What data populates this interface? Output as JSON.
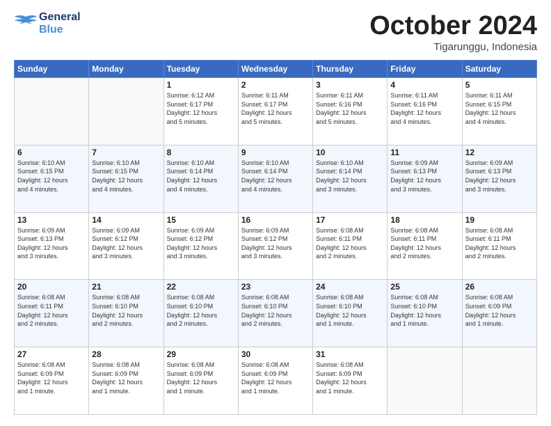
{
  "header": {
    "logo": {
      "line1": "General",
      "line2": "Blue"
    },
    "title": "October 2024",
    "subtitle": "Tigarunggu, Indonesia"
  },
  "days_of_week": [
    "Sunday",
    "Monday",
    "Tuesday",
    "Wednesday",
    "Thursday",
    "Friday",
    "Saturday"
  ],
  "weeks": [
    [
      {
        "day": "",
        "text": ""
      },
      {
        "day": "",
        "text": ""
      },
      {
        "day": "1",
        "text": "Sunrise: 6:12 AM\nSunset: 6:17 PM\nDaylight: 12 hours\nand 5 minutes."
      },
      {
        "day": "2",
        "text": "Sunrise: 6:11 AM\nSunset: 6:17 PM\nDaylight: 12 hours\nand 5 minutes."
      },
      {
        "day": "3",
        "text": "Sunrise: 6:11 AM\nSunset: 6:16 PM\nDaylight: 12 hours\nand 5 minutes."
      },
      {
        "day": "4",
        "text": "Sunrise: 6:11 AM\nSunset: 6:16 PM\nDaylight: 12 hours\nand 4 minutes."
      },
      {
        "day": "5",
        "text": "Sunrise: 6:11 AM\nSunset: 6:15 PM\nDaylight: 12 hours\nand 4 minutes."
      }
    ],
    [
      {
        "day": "6",
        "text": "Sunrise: 6:10 AM\nSunset: 6:15 PM\nDaylight: 12 hours\nand 4 minutes."
      },
      {
        "day": "7",
        "text": "Sunrise: 6:10 AM\nSunset: 6:15 PM\nDaylight: 12 hours\nand 4 minutes."
      },
      {
        "day": "8",
        "text": "Sunrise: 6:10 AM\nSunset: 6:14 PM\nDaylight: 12 hours\nand 4 minutes."
      },
      {
        "day": "9",
        "text": "Sunrise: 6:10 AM\nSunset: 6:14 PM\nDaylight: 12 hours\nand 4 minutes."
      },
      {
        "day": "10",
        "text": "Sunrise: 6:10 AM\nSunset: 6:14 PM\nDaylight: 12 hours\nand 3 minutes."
      },
      {
        "day": "11",
        "text": "Sunrise: 6:09 AM\nSunset: 6:13 PM\nDaylight: 12 hours\nand 3 minutes."
      },
      {
        "day": "12",
        "text": "Sunrise: 6:09 AM\nSunset: 6:13 PM\nDaylight: 12 hours\nand 3 minutes."
      }
    ],
    [
      {
        "day": "13",
        "text": "Sunrise: 6:09 AM\nSunset: 6:13 PM\nDaylight: 12 hours\nand 3 minutes."
      },
      {
        "day": "14",
        "text": "Sunrise: 6:09 AM\nSunset: 6:12 PM\nDaylight: 12 hours\nand 3 minutes."
      },
      {
        "day": "15",
        "text": "Sunrise: 6:09 AM\nSunset: 6:12 PM\nDaylight: 12 hours\nand 3 minutes."
      },
      {
        "day": "16",
        "text": "Sunrise: 6:09 AM\nSunset: 6:12 PM\nDaylight: 12 hours\nand 3 minutes."
      },
      {
        "day": "17",
        "text": "Sunrise: 6:08 AM\nSunset: 6:11 PM\nDaylight: 12 hours\nand 2 minutes."
      },
      {
        "day": "18",
        "text": "Sunrise: 6:08 AM\nSunset: 6:11 PM\nDaylight: 12 hours\nand 2 minutes."
      },
      {
        "day": "19",
        "text": "Sunrise: 6:08 AM\nSunset: 6:11 PM\nDaylight: 12 hours\nand 2 minutes."
      }
    ],
    [
      {
        "day": "20",
        "text": "Sunrise: 6:08 AM\nSunset: 6:11 PM\nDaylight: 12 hours\nand 2 minutes."
      },
      {
        "day": "21",
        "text": "Sunrise: 6:08 AM\nSunset: 6:10 PM\nDaylight: 12 hours\nand 2 minutes."
      },
      {
        "day": "22",
        "text": "Sunrise: 6:08 AM\nSunset: 6:10 PM\nDaylight: 12 hours\nand 2 minutes."
      },
      {
        "day": "23",
        "text": "Sunrise: 6:08 AM\nSunset: 6:10 PM\nDaylight: 12 hours\nand 2 minutes."
      },
      {
        "day": "24",
        "text": "Sunrise: 6:08 AM\nSunset: 6:10 PM\nDaylight: 12 hours\nand 1 minute."
      },
      {
        "day": "25",
        "text": "Sunrise: 6:08 AM\nSunset: 6:10 PM\nDaylight: 12 hours\nand 1 minute."
      },
      {
        "day": "26",
        "text": "Sunrise: 6:08 AM\nSunset: 6:09 PM\nDaylight: 12 hours\nand 1 minute."
      }
    ],
    [
      {
        "day": "27",
        "text": "Sunrise: 6:08 AM\nSunset: 6:09 PM\nDaylight: 12 hours\nand 1 minute."
      },
      {
        "day": "28",
        "text": "Sunrise: 6:08 AM\nSunset: 6:09 PM\nDaylight: 12 hours\nand 1 minute."
      },
      {
        "day": "29",
        "text": "Sunrise: 6:08 AM\nSunset: 6:09 PM\nDaylight: 12 hours\nand 1 minute."
      },
      {
        "day": "30",
        "text": "Sunrise: 6:08 AM\nSunset: 6:09 PM\nDaylight: 12 hours\nand 1 minute."
      },
      {
        "day": "31",
        "text": "Sunrise: 6:08 AM\nSunset: 6:09 PM\nDaylight: 12 hours\nand 1 minute."
      },
      {
        "day": "",
        "text": ""
      },
      {
        "day": "",
        "text": ""
      }
    ]
  ]
}
